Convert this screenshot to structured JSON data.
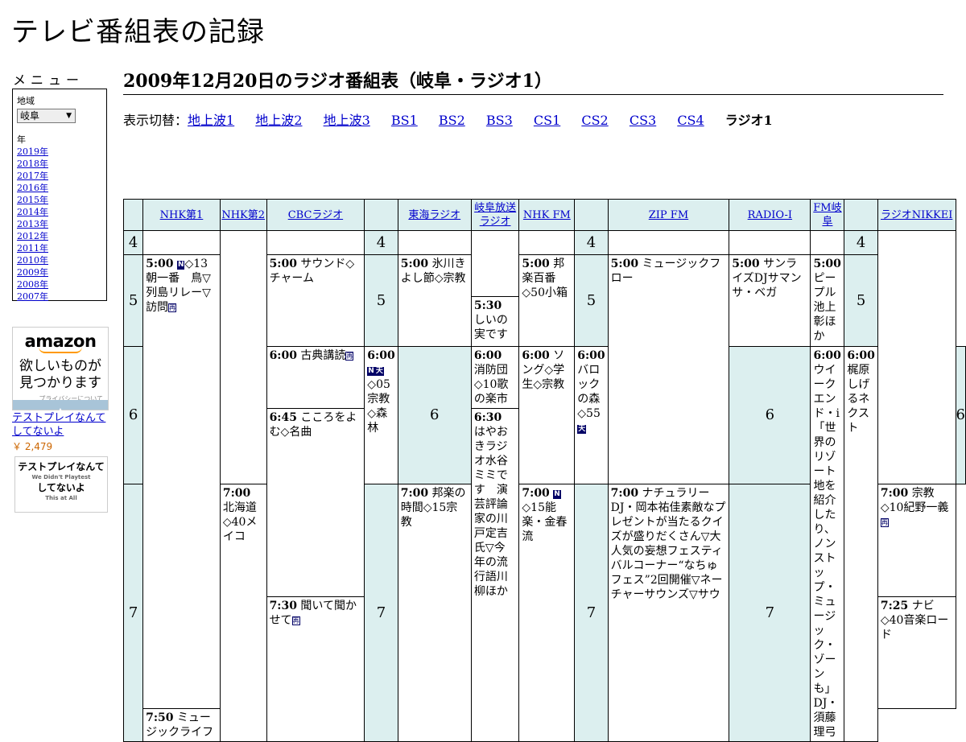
{
  "site_title": "テレビ番組表の記録",
  "menu": {
    "heading": "メニュー",
    "region_label": "地域",
    "region_value": "岐阜",
    "year_label": "年",
    "years": [
      "2019年",
      "2018年",
      "2017年",
      "2016年",
      "2015年",
      "2014年",
      "2013年",
      "2012年",
      "2011年",
      "2010年",
      "2009年",
      "2008年",
      "2007年"
    ]
  },
  "ad": {
    "logo": "amazon",
    "text1": "欲しいものが",
    "text2": "見つかります",
    "privacy": "プライバシーについて",
    "product": "テストプレイなんてしてないよ",
    "price": "￥ 2,479",
    "book_title1": "テストプレイなんて",
    "book_sub1": "We Didn't Playtest",
    "book_title2": "してないよ",
    "book_sub2": "This at All"
  },
  "page_title": "2009年12月20日のラジオ番組表（岐阜・ラジオ1）",
  "switcher": {
    "label": "表示切替：",
    "links": [
      "地上波1",
      "地上波2",
      "地上波3",
      "BS1",
      "BS2",
      "BS3",
      "CS1",
      "CS2",
      "CS3",
      "CS4"
    ],
    "current": "ラジオ1"
  },
  "channels": [
    "NHK第1",
    "NHK第2",
    "CBCラジオ",
    "東海ラジオ",
    "岐阜放送ラジオ",
    "NHK FM",
    "ZIP FM",
    "RADIO-I",
    "FM岐阜",
    "ラジオNIKKEI"
  ],
  "hours": [
    "4",
    "5",
    "6",
    "7"
  ],
  "programs": {
    "nhk1_500": {
      "time": "5:00",
      "text": "◇13朝一番　鳥▽列島リレー▽訪問"
    },
    "nhk2_600": {
      "time": "6:00",
      "text": "古典講読"
    },
    "nhk2_645": {
      "time": "6:45",
      "text": "こころをよむ◇名曲"
    },
    "nhk2_730": {
      "time": "7:30",
      "text": "聞いて聞かせて"
    },
    "cbc_500": {
      "time": "5:00",
      "text": "サウンド◇チャーム"
    },
    "cbc_600": {
      "time": "6:00",
      "text": "◇05宗教◇森林"
    },
    "cbc_700": {
      "time": "7:00",
      "text": "北海道◇40メイコ"
    },
    "tokai_500": {
      "time": "5:00",
      "text": "氷川きよし節◇宗教"
    },
    "tokai_600": {
      "time": "6:00",
      "text": "消防団◇10歌の楽市"
    },
    "tokai_630": {
      "time": "6:30",
      "text": "はやおきラジオ水谷ミミです　演芸評論家の川戸定吉氏▽今年の流行語川柳ほか"
    },
    "gifu_530": {
      "time": "5:30",
      "text": "しいの実です"
    },
    "gifu_600": {
      "time": "6:00",
      "text": "ソング◇学生◇宗教"
    },
    "gifu_700": {
      "time": "7:00",
      "text": "邦楽の時間◇15宗教"
    },
    "nhkfm_500": {
      "time": "5:00",
      "text": "邦楽百番◇50小箱"
    },
    "nhkfm_600": {
      "time": "6:00",
      "text": "バロックの森◇55"
    },
    "nhkfm_700": {
      "time": "7:00",
      "text": "◇15能楽・金春流"
    },
    "zip_500": {
      "time": "5:00",
      "text": "ミュージックフロー"
    },
    "zip_700": {
      "time": "7:00",
      "text": "ナチュラリーDJ・岡本祐佳素敵なプレゼントが当たるクイズが盛りだくさん▽大人気の妄想フェスティバルコーナー“なちゅフェス”2回開催▽ネーチャーサウンズ▽サウ"
    },
    "radioi_500": {
      "time": "5:00",
      "text": "サンライズDJサマンサ・ベガ"
    },
    "radioi_600": {
      "time": "6:00",
      "text": "ウイークエンド・i「世界のリゾート地を紹介したり、ノンストップ・ミュージック・ゾーンも」DJ・須藤理弓"
    },
    "fmgifu_500": {
      "time": "5:00",
      "text": "ピープル池上彰ほか"
    },
    "fmgifu_600": {
      "time": "6:00",
      "text": "梶原しげるネクスト"
    },
    "nikkei_700": {
      "time": "7:00",
      "text": "宗教◇10紀野一義"
    },
    "nikkei_725": {
      "time": "7:25",
      "text": "ナビ◇40音楽ロード"
    },
    "nikkei_750": {
      "time": "7:50",
      "text": "ミュージックライフ"
    }
  },
  "badges": {
    "news": "N",
    "weather": "天",
    "repeat": "再"
  }
}
